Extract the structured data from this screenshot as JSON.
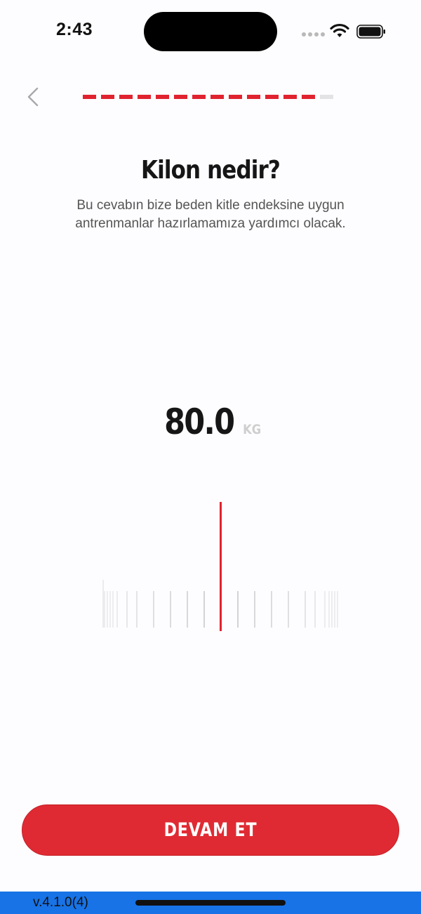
{
  "status_bar": {
    "time": "2:43",
    "icons": [
      "cellular-signal-icon",
      "wifi-icon",
      "battery-icon"
    ]
  },
  "header": {
    "back_icon": "chevron-left-icon",
    "progress": {
      "completed_steps": 13,
      "total_steps": 14,
      "accent": "#e0232f",
      "track": "#e3e3e6"
    }
  },
  "question": {
    "title": "Kilon nedir?",
    "subtitle": "Bu cevabın bize beden kitle endeksine uygun antrenmanlar hazırlamamıza yardımcı olacak."
  },
  "weight_picker": {
    "value": "80.0",
    "unit": "KG",
    "indicator_color": "#e0232f"
  },
  "actions": {
    "continue_label": "DEVAM ET",
    "continue_color": "#e02a33"
  },
  "footer": {
    "version": "v.4.1.0(4)",
    "bar_color": "#1773e6"
  }
}
